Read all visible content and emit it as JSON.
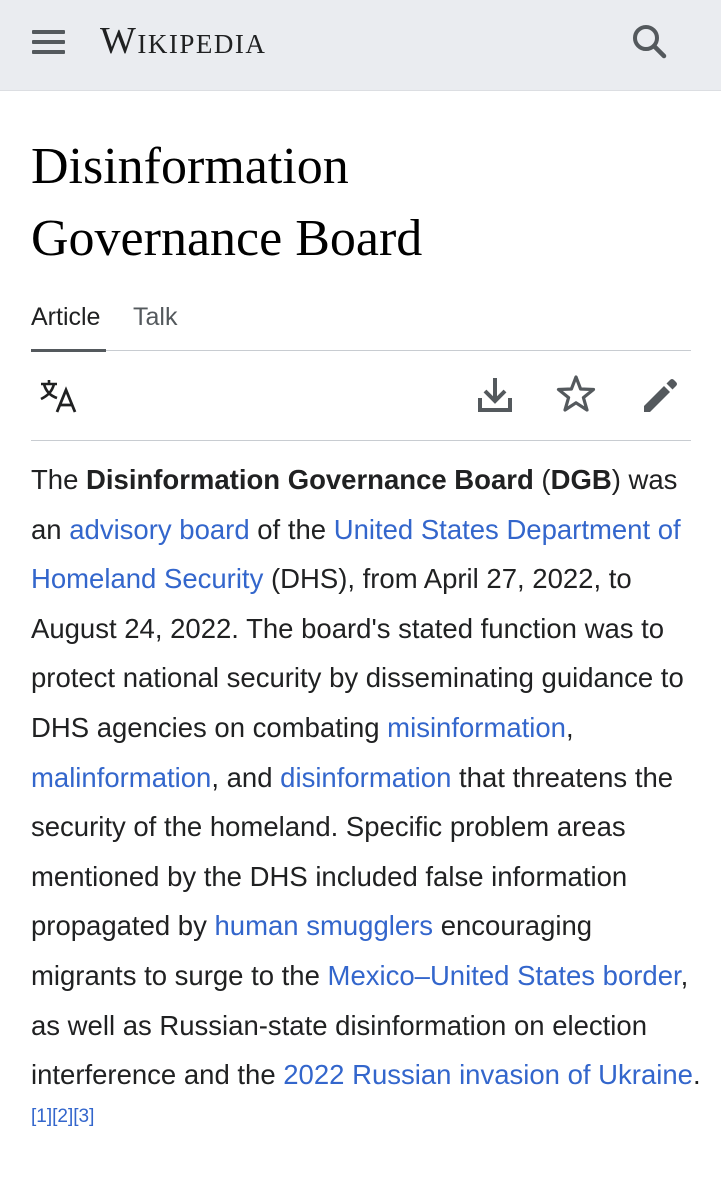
{
  "header": {
    "wordmark": "Wikipedia",
    "menu_icon": "hamburger-menu-icon",
    "search_icon": "search-icon"
  },
  "page": {
    "title_line1": "Disinformation",
    "title_line2": "Governance Board"
  },
  "tabs": [
    {
      "label": "Article",
      "active": true
    },
    {
      "label": "Talk",
      "active": false
    }
  ],
  "toolbar": {
    "language_icon": "language-icon",
    "download_icon": "download-icon",
    "watch_icon": "star-icon",
    "edit_icon": "pencil-icon"
  },
  "article": {
    "p1_the": "The ",
    "p1_bold_name": "Disinformation Governance Board",
    "p1_paren_open": " (",
    "p1_bold_abbr": "DGB",
    "p1_after_abbr": ") was an ",
    "link_advisory_board": "advisory board",
    "p1_of_the": " of the ",
    "link_dhs": "United States Department of Homeland Security",
    "p1_dates": " (DHS), from April 27, 2022, to August 24, 2022. The board's stated function was to protect national security by disseminating guidance to DHS agencies on combating ",
    "link_misinformation": "misinformation",
    "comma1": ", ",
    "link_malinformation": "malinformation",
    "and": ", and ",
    "link_disinformation": "disinformation",
    "p1_threatens": " that threatens the security of the homeland. Specific problem areas mentioned by the DHS included false information propagated by ",
    "link_human_smugglers": "human smugglers",
    "p1_encouraging": " encouraging migrants to surge to the ",
    "link_border": "Mexico–United States border",
    "p1_aswell": ", as well as Russian-state disinformation on election interference and the ",
    "link_invasion": "2022 Russian invasion of Ukraine",
    "period": ".",
    "ref1": "[1]",
    "ref2": "[2]",
    "ref3": "[3]"
  },
  "colors": {
    "link": "#3366cc",
    "header_bg": "#eaecf0",
    "text": "#202122"
  }
}
